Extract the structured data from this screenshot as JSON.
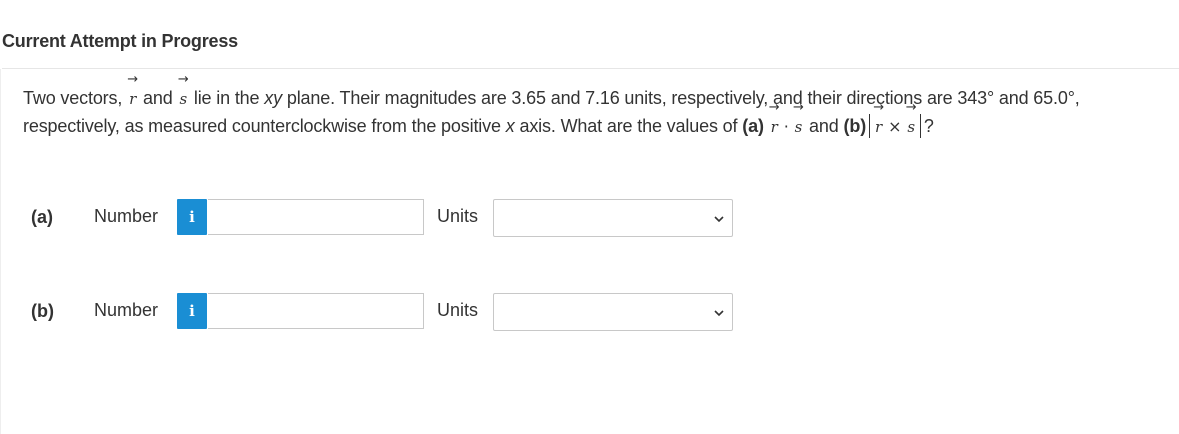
{
  "header": {
    "title": "Current Attempt in Progress"
  },
  "question": {
    "t1": "Two vectors,",
    "vec_r": "r",
    "t2": "and",
    "vec_s": "s",
    "t3": "lie in the",
    "xy": "xy",
    "t4": "plane. Their magnitudes are 3.65 and 7.16 units, respectively, and their directions are 343° and 65.0°, respectively, as measured counterclockwise from the positive",
    "x": "x",
    "t5": "axis. What are the values of",
    "part_a": "(a)",
    "dot": "·",
    "t6": "and",
    "part_b": "(b)",
    "cross": "×",
    "end": "?"
  },
  "parts": [
    {
      "label": "(a)",
      "number_label": "Number",
      "info_icon": "i",
      "value": "",
      "units_label": "Units",
      "units_selected": ""
    },
    {
      "label": "(b)",
      "number_label": "Number",
      "info_icon": "i",
      "value": "",
      "units_label": "Units",
      "units_selected": ""
    }
  ],
  "colors": {
    "info_button": "#1a8ed4",
    "text": "#333333",
    "border": "#c8c8c8"
  }
}
